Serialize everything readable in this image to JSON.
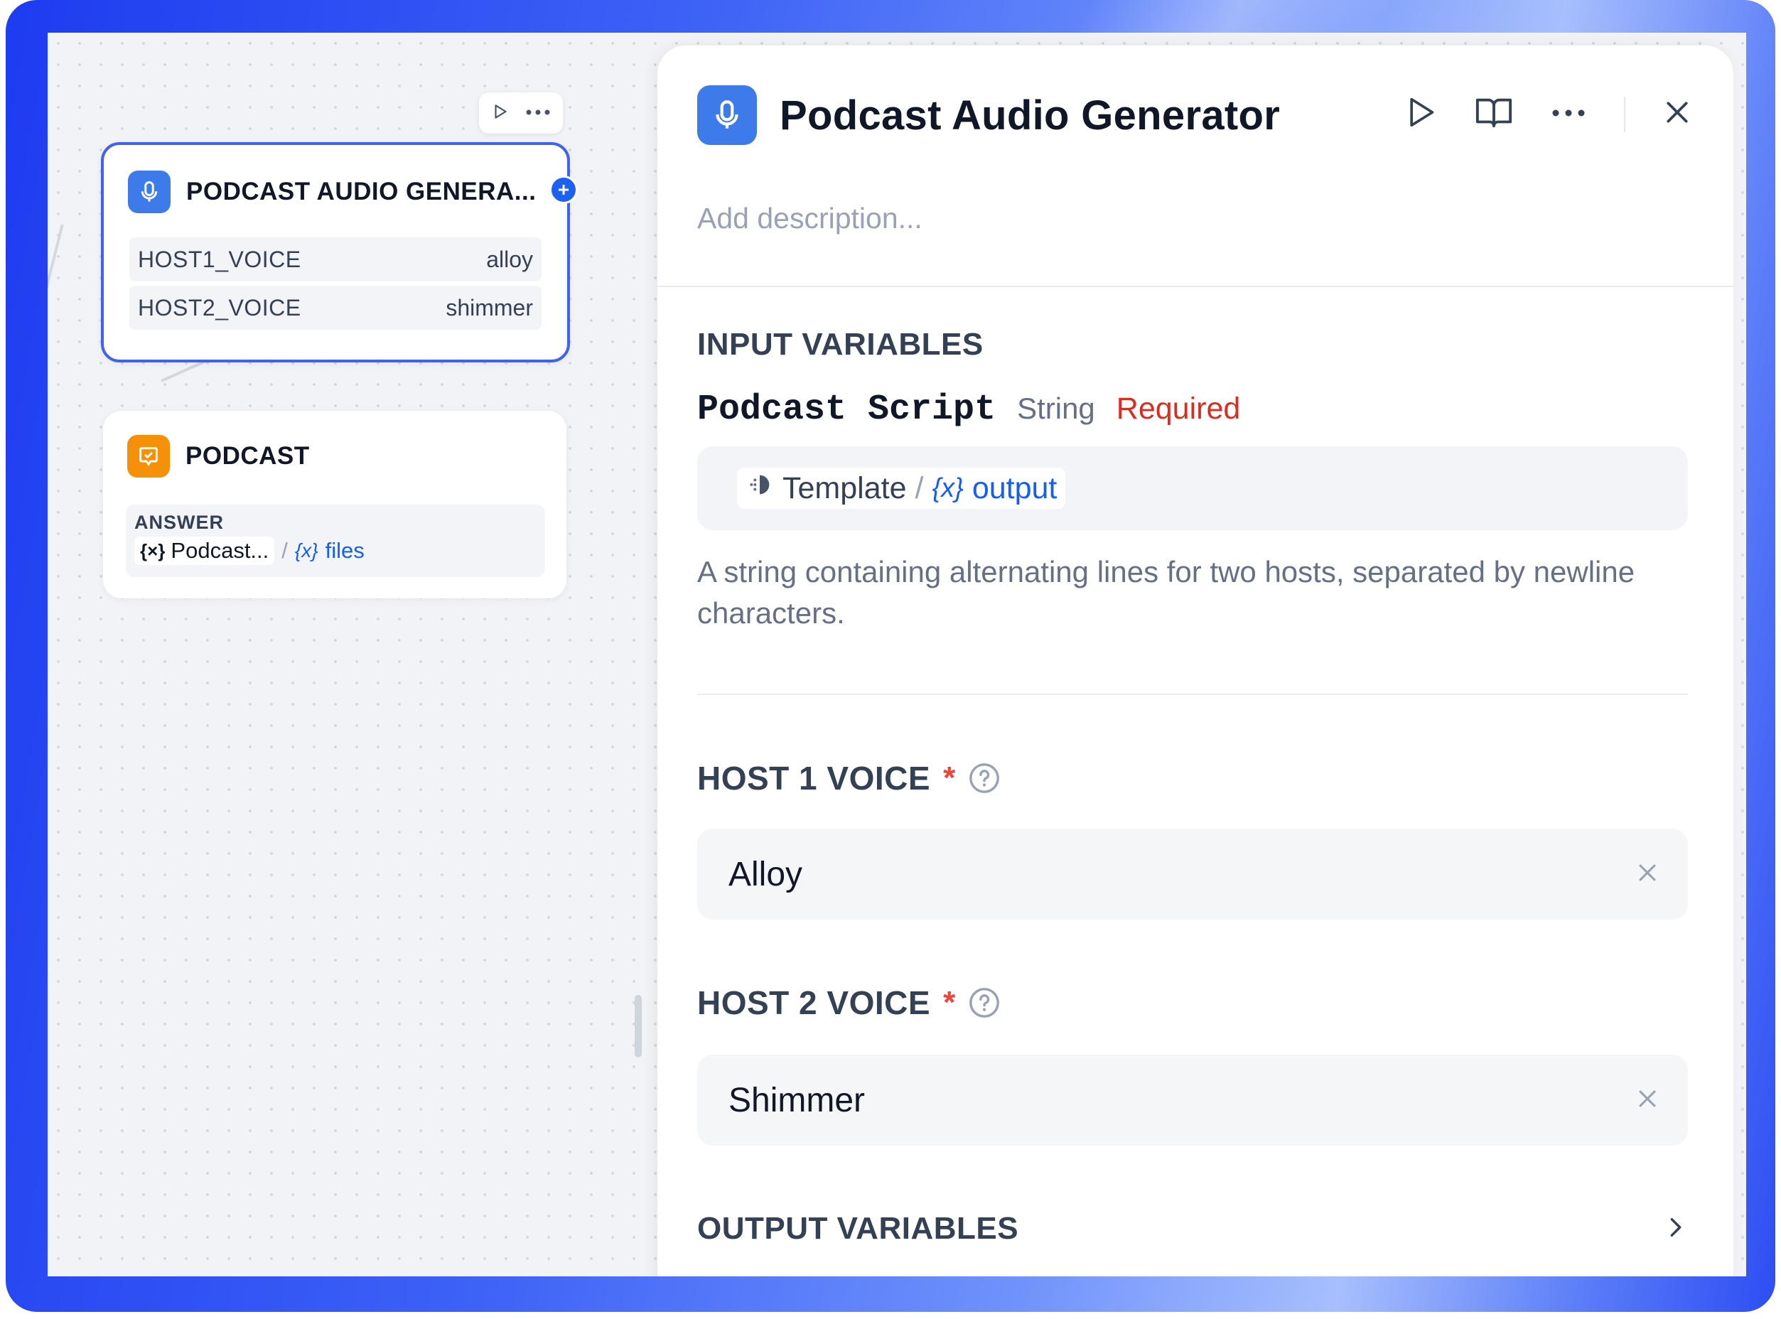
{
  "canvas": {
    "node_audio": {
      "title": "PODCAST AUDIO GENERA...",
      "variables": [
        {
          "key": "HOST1_VOICE",
          "value": "alloy"
        },
        {
          "key": "HOST2_VOICE",
          "value": "shimmer"
        }
      ]
    },
    "node_answer": {
      "title": "PODCAST",
      "answer_label": "ANSWER",
      "source_chip": "Podcast...",
      "source_var": "files"
    }
  },
  "panel": {
    "title": "Podcast Audio Generator",
    "description_placeholder": "Add description...",
    "input_section_title": "INPUT VARIABLES",
    "input_var": {
      "name": "Podcast Script",
      "type": "String",
      "required_label": "Required",
      "template_label": "Template",
      "template_var": "output",
      "help": "A string containing alternating lines for two hosts, separated by newline characters."
    },
    "host1": {
      "label": "HOST 1 VOICE",
      "required_mark": "*",
      "value": "Alloy"
    },
    "host2": {
      "label": "HOST 2 VOICE",
      "required_mark": "*",
      "value": "Shimmer"
    },
    "output_section_title": "OUTPUT VARIABLES"
  },
  "colors": {
    "accent": "#155eef",
    "node_border": "#3f63f0",
    "required": "#d92d20",
    "answer_icon": "#f79009"
  }
}
